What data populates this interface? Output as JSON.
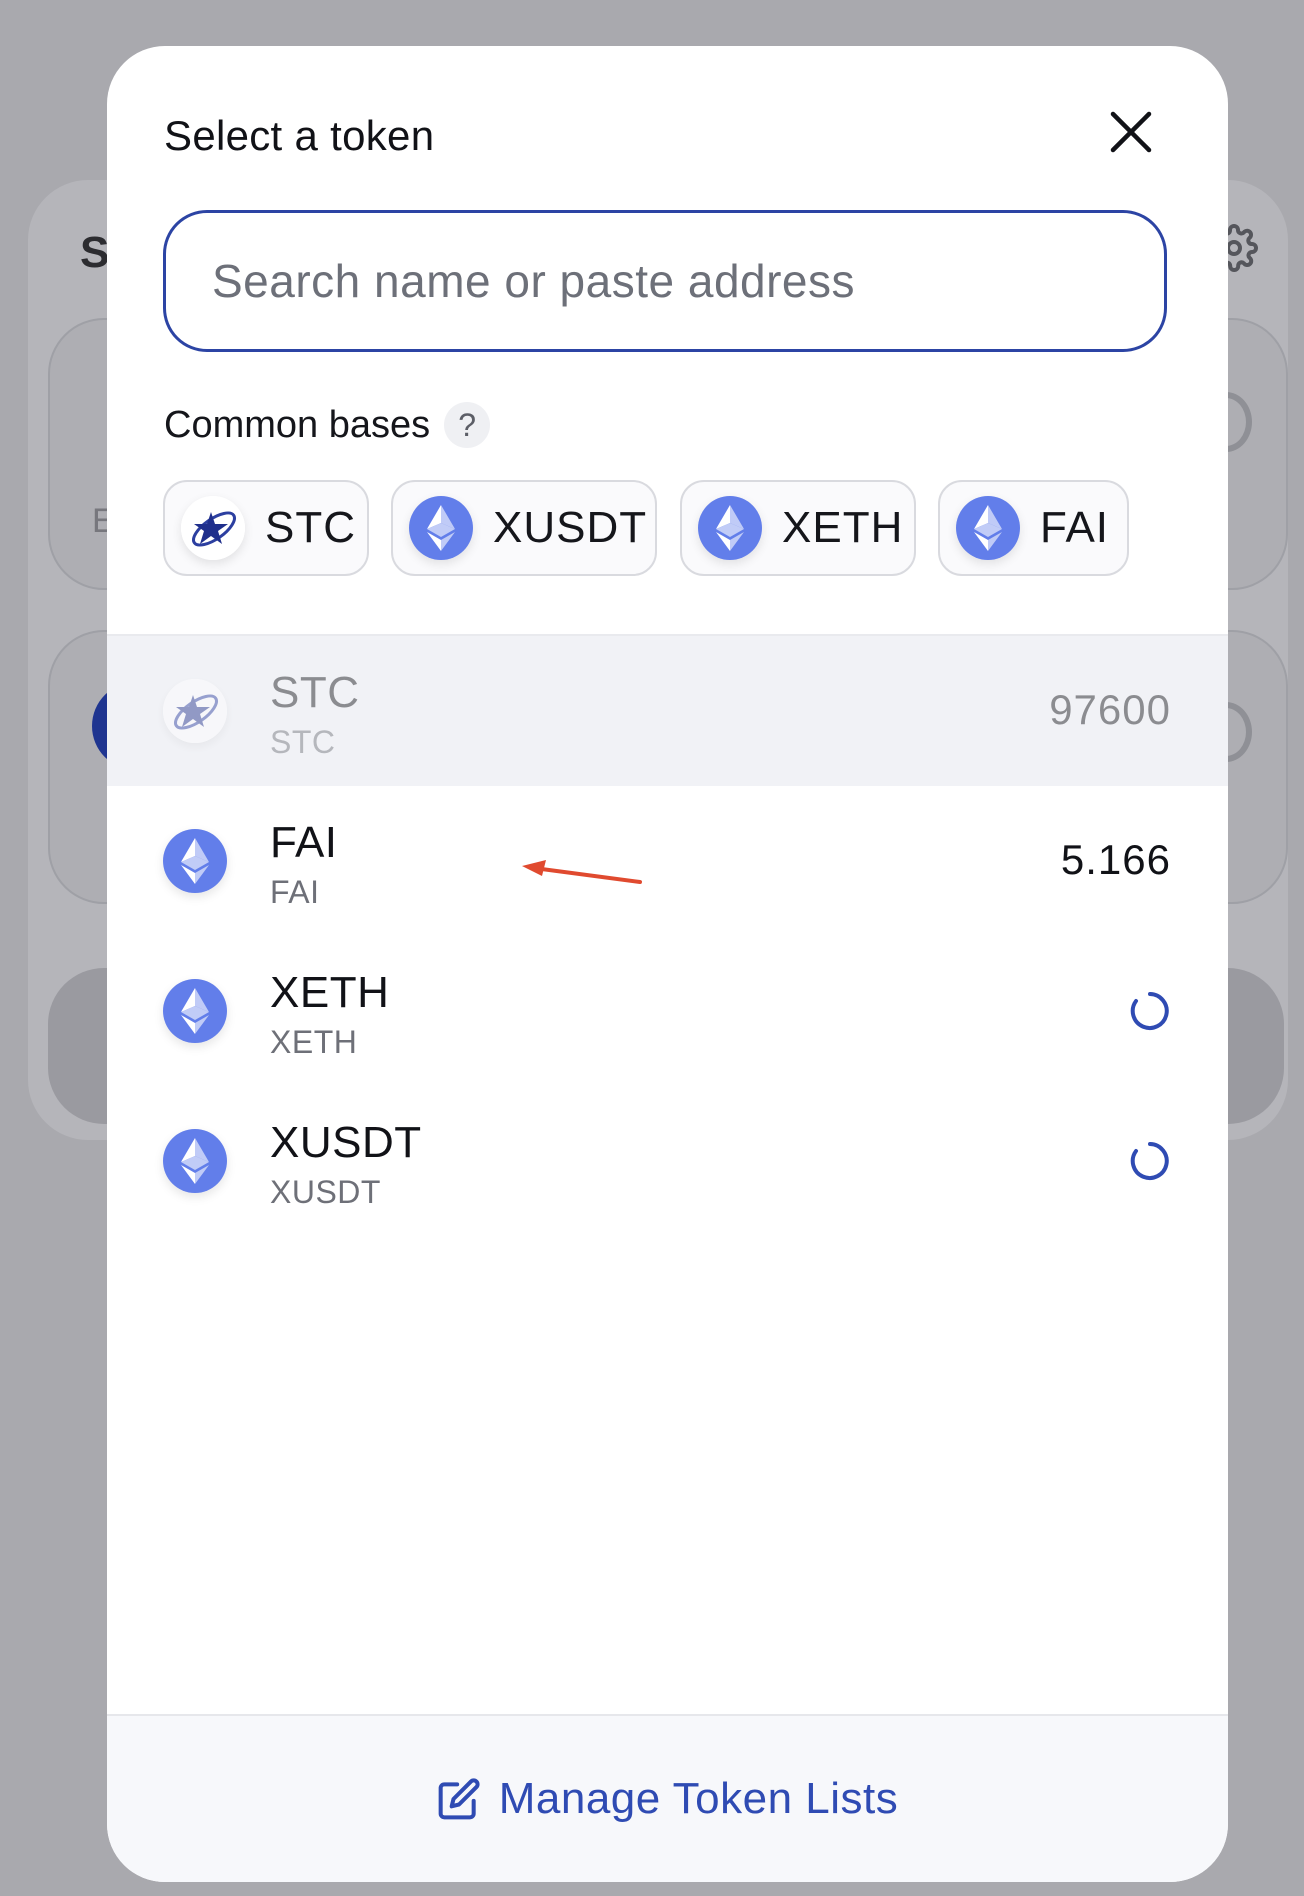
{
  "background": {
    "partial_title": "S",
    "partial_label": "E"
  },
  "modal": {
    "title": "Select a token",
    "search": {
      "placeholder": "Search name or paste address",
      "value": ""
    },
    "common_bases": {
      "label": "Common bases",
      "help": "?",
      "items": [
        {
          "symbol": "STC",
          "icon": "stc-logo-icon"
        },
        {
          "symbol": "XUSDT",
          "icon": "ethereum-icon"
        },
        {
          "symbol": "XETH",
          "icon": "ethereum-icon"
        },
        {
          "symbol": "FAI",
          "icon": "ethereum-icon"
        }
      ]
    },
    "tokens": [
      {
        "symbol": "STC",
        "name": "STC",
        "balance": "97600",
        "icon": "stc-logo-icon",
        "selected": true,
        "loading": false
      },
      {
        "symbol": "FAI",
        "name": "FAI",
        "balance": "5.166",
        "icon": "ethereum-icon",
        "selected": false,
        "loading": false
      },
      {
        "symbol": "XETH",
        "name": "XETH",
        "balance": "",
        "icon": "ethereum-icon",
        "selected": false,
        "loading": true
      },
      {
        "symbol": "XUSDT",
        "name": "XUSDT",
        "balance": "",
        "icon": "ethereum-icon",
        "selected": false,
        "loading": true
      }
    ],
    "footer": {
      "manage_label": "Manage Token Lists"
    }
  },
  "colors": {
    "accent": "#2f4bb3",
    "search_border": "#2c44a4",
    "eth_icon": "#627eea",
    "annotation_arrow": "#e04a2f",
    "overlay": "#a9a9ae"
  }
}
